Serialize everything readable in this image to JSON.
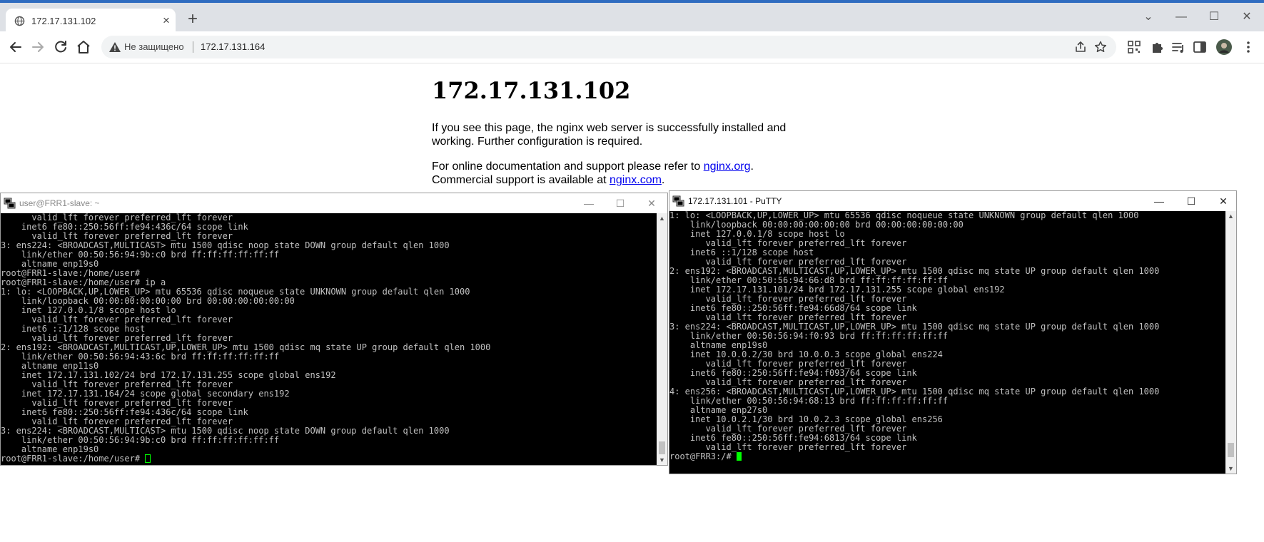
{
  "browser": {
    "tab_title": "172.17.131.102",
    "tab_close": "×",
    "new_tab": "+",
    "insecure_label": "Не защищено",
    "url": "172.17.131.164",
    "window_controls": {
      "tab_search": "⌄",
      "minimize": "—",
      "maximize": "☐",
      "close": "✕"
    }
  },
  "page": {
    "heading": "172.17.131.102",
    "p1": "If you see this page, the nginx web server is successfully installed and working. Further configuration is required.",
    "p2_before": "For online documentation and support please refer to ",
    "p2_link": "nginx.org",
    "p2_after": ".",
    "p3_before": "Commercial support is available at ",
    "p3_link": "nginx.com",
    "p3_after": "."
  },
  "terminal_left": {
    "title": "user@FRR1-slave: ~",
    "controls": {
      "minimize": "—",
      "maximize": "☐",
      "close": "✕"
    },
    "lines": [
      "      valid_lft forever preferred_lft forever",
      "    inet6 fe80::250:56ff:fe94:436c/64 scope link",
      "      valid_lft forever preferred_lft forever",
      "3: ens224: <BROADCAST,MULTICAST> mtu 1500 qdisc noop state DOWN group default qlen 1000",
      "    link/ether 00:50:56:94:9b:c0 brd ff:ff:ff:ff:ff:ff",
      "    altname enp19s0",
      "root@FRR1-slave:/home/user#",
      "root@FRR1-slave:/home/user# ip a",
      "1: lo: <LOOPBACK,UP,LOWER_UP> mtu 65536 qdisc noqueue state UNKNOWN group default qlen 1000",
      "    link/loopback 00:00:00:00:00:00 brd 00:00:00:00:00:00",
      "    inet 127.0.0.1/8 scope host lo",
      "      valid_lft forever preferred_lft forever",
      "    inet6 ::1/128 scope host",
      "      valid_lft forever preferred_lft forever",
      "2: ens192: <BROADCAST,MULTICAST,UP,LOWER_UP> mtu 1500 qdisc mq state UP group default qlen 1000",
      "    link/ether 00:50:56:94:43:6c brd ff:ff:ff:ff:ff:ff",
      "    altname enp11s0",
      "    inet 172.17.131.102/24 brd 172.17.131.255 scope global ens192",
      "      valid_lft forever preferred_lft forever",
      "    inet 172.17.131.164/24 scope global secondary ens192",
      "      valid_lft forever preferred_lft forever",
      "    inet6 fe80::250:56ff:fe94:436c/64 scope link",
      "      valid_lft forever preferred_lft forever",
      "3: ens224: <BROADCAST,MULTICAST> mtu 1500 qdisc noop state DOWN group default qlen 1000",
      "    link/ether 00:50:56:94:9b:c0 brd ff:ff:ff:ff:ff:ff",
      "    altname enp19s0"
    ],
    "prompt": "root@FRR1-slave:/home/user# "
  },
  "terminal_right": {
    "title": "172.17.131.101 - PuTTY",
    "controls": {
      "minimize": "—",
      "maximize": "☐",
      "close": "✕"
    },
    "lines": [
      "1: lo: <LOOPBACK,UP,LOWER_UP> mtu 65536 qdisc noqueue state UNKNOWN group default qlen 1000",
      "    link/loopback 00:00:00:00:00:00 brd 00:00:00:00:00:00",
      "    inet 127.0.0.1/8 scope host lo",
      "       valid_lft forever preferred_lft forever",
      "    inet6 ::1/128 scope host",
      "       valid_lft forever preferred_lft forever",
      "2: ens192: <BROADCAST,MULTICAST,UP,LOWER_UP> mtu 1500 qdisc mq state UP group default qlen 1000",
      "    link/ether 00:50:56:94:66:d8 brd ff:ff:ff:ff:ff:ff",
      "    inet 172.17.131.101/24 brd 172.17.131.255 scope global ens192",
      "       valid_lft forever preferred_lft forever",
      "    inet6 fe80::250:56ff:fe94:66d8/64 scope link",
      "       valid_lft forever preferred_lft forever",
      "3: ens224: <BROADCAST,MULTICAST,UP,LOWER_UP> mtu 1500 qdisc mq state UP group default qlen 1000",
      "    link/ether 00:50:56:94:f0:93 brd ff:ff:ff:ff:ff:ff",
      "    altname enp19s0",
      "    inet 10.0.0.2/30 brd 10.0.0.3 scope global ens224",
      "       valid_lft forever preferred_lft forever",
      "    inet6 fe80::250:56ff:fe94:f093/64 scope link",
      "       valid_lft forever preferred_lft forever",
      "4: ens256: <BROADCAST,MULTICAST,UP,LOWER_UP> mtu 1500 qdisc mq state UP group default qlen 1000",
      "    link/ether 00:50:56:94:68:13 brd ff:ff:ff:ff:ff:ff",
      "    altname enp27s0",
      "    inet 10.0.2.1/30 brd 10.0.2.3 scope global ens256",
      "       valid_lft forever preferred_lft forever",
      "    inet6 fe80::250:56ff:fe94:6813/64 scope link",
      "       valid_lft forever preferred_lft forever"
    ],
    "prompt": "root@FRR3:/# "
  },
  "colors": {
    "accent": "#2f6cc0",
    "link": "#0000ee",
    "terminal_bg": "#000000",
    "terminal_fg": "#c0c0c0",
    "cursor": "#00ff00"
  }
}
